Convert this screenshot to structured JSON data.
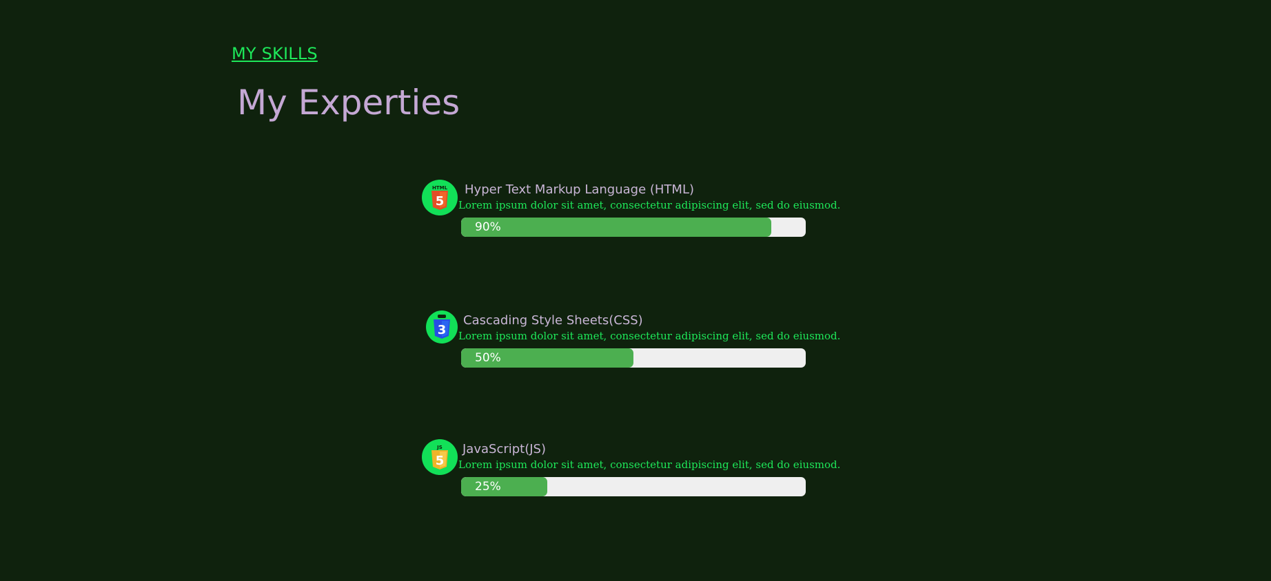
{
  "header": {
    "section_tag": "MY SKILLS",
    "title": "My Experties"
  },
  "skills": [
    {
      "icon": "html5-icon",
      "name": "Hyper Text Markup Language (HTML)",
      "description": "Lorem ipsum dolor sit amet, consectetur adipiscing elit, sed do eiusmod.",
      "percent_label": "90%",
      "level": 90
    },
    {
      "icon": "css3-icon",
      "name": "Cascading Style Sheets(CSS)",
      "description": "Lorem ipsum dolor sit amet, consectetur adipiscing elit, sed do eiusmod.",
      "percent_label": "50%",
      "level": 50
    },
    {
      "icon": "javascript-icon",
      "name": "JavaScript(JS)",
      "description": "Lorem ipsum dolor sit amet, consectetur adipiscing elit, sed do eiusmod.",
      "percent_label": "25%",
      "level": 25
    }
  ],
  "colors": {
    "background": "#0f220d",
    "accent_green": "#1ee85a",
    "title": "#c4a8d4",
    "bar_fill": "#4caf50",
    "bar_track": "#efefef",
    "html_shield": "#e44d26",
    "css_shield": "#264de4",
    "js_shield": "#f0b429"
  }
}
